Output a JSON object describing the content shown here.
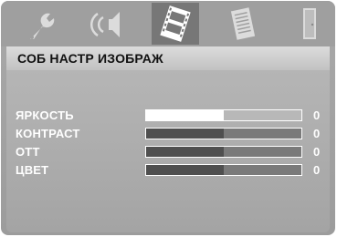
{
  "tabs": [
    {
      "name": "settings",
      "icon": "wrench-icon",
      "active": false
    },
    {
      "name": "audio",
      "icon": "speaker-icon",
      "active": false
    },
    {
      "name": "video",
      "icon": "film-icon",
      "active": true
    },
    {
      "name": "preferences",
      "icon": "document-icon",
      "active": false
    },
    {
      "name": "exit",
      "icon": "exit-door-icon",
      "active": false
    }
  ],
  "menu": {
    "title": "СОБ НАСТР ИЗОБРАЖ"
  },
  "settings": [
    {
      "label": "ЯРКОСТЬ",
      "value": "0",
      "level": 0.5,
      "selected": true
    },
    {
      "label": "КОНТРАСТ",
      "value": "0",
      "level": 0.5,
      "selected": false
    },
    {
      "label": "ОТТ",
      "value": "0",
      "level": 0.5,
      "selected": false
    },
    {
      "label": "ЦВЕТ",
      "value": "0",
      "level": 0.5,
      "selected": false
    }
  ],
  "colors": {
    "background": "#a4a4a4",
    "title_bar": "#c8c8c8",
    "label_text": "#ffffff",
    "slider_fill": "#4f4f4f",
    "selected_fill": "#ffffff"
  }
}
